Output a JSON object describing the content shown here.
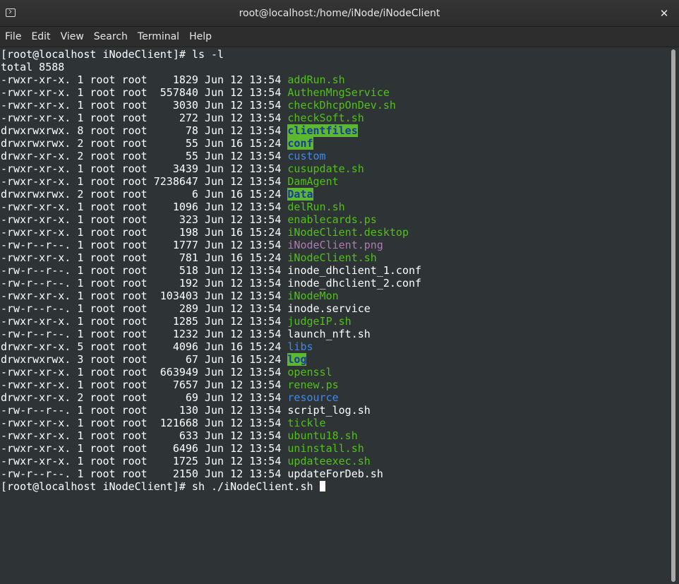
{
  "window": {
    "title": "root@localhost:/home/iNode/iNodeClient",
    "close_label": "✕"
  },
  "menu": {
    "items": [
      "File",
      "Edit",
      "View",
      "Search",
      "Terminal",
      "Help"
    ]
  },
  "terminal": {
    "prompt1": "[root@localhost iNodeClient]# ls -l",
    "total": "total 8588",
    "entries": [
      {
        "meta": "-rwxr-xr-x. 1 root root    1829 Jun 12 13:54 ",
        "name": "addRun.sh",
        "type": "exec"
      },
      {
        "meta": "-rwxr-xr-x. 1 root root  557840 Jun 12 13:54 ",
        "name": "AuthenMngService",
        "type": "exec"
      },
      {
        "meta": "-rwxr-xr-x. 1 root root    3030 Jun 12 13:54 ",
        "name": "checkDhcpOnDev.sh",
        "type": "exec"
      },
      {
        "meta": "-rwxr-xr-x. 1 root root     272 Jun 12 13:54 ",
        "name": "checkSoft.sh",
        "type": "exec"
      },
      {
        "meta": "drwxrwxrwx. 8 root root      78 Jun 12 13:54 ",
        "name": "clientfiles",
        "type": "sticky"
      },
      {
        "meta": "drwxrwxrwx. 2 root root      55 Jun 16 15:24 ",
        "name": "conf",
        "type": "sticky"
      },
      {
        "meta": "drwxr-xr-x. 2 root root      55 Jun 12 13:54 ",
        "name": "custom",
        "type": "dir"
      },
      {
        "meta": "-rwxr-xr-x. 1 root root    3439 Jun 12 13:54 ",
        "name": "cusupdate.sh",
        "type": "exec"
      },
      {
        "meta": "-rwxr-xr-x. 1 root root 7238647 Jun 12 13:54 ",
        "name": "DamAgent",
        "type": "exec"
      },
      {
        "meta": "drwxrwxrwx. 2 root root       6 Jun 16 15:24 ",
        "name": "Data",
        "type": "sticky"
      },
      {
        "meta": "-rwxr-xr-x. 1 root root    1096 Jun 12 13:54 ",
        "name": "delRun.sh",
        "type": "exec"
      },
      {
        "meta": "-rwxr-xr-x. 1 root root     323 Jun 12 13:54 ",
        "name": "enablecards.ps",
        "type": "exec"
      },
      {
        "meta": "-rwxr-xr-x. 1 root root     198 Jun 16 15:24 ",
        "name": "iNodeClient.desktop",
        "type": "exec"
      },
      {
        "meta": "-rw-r--r--. 1 root root    1777 Jun 12 13:54 ",
        "name": "iNodeClient.png",
        "type": "img"
      },
      {
        "meta": "-rwxr-xr-x. 1 root root     781 Jun 16 15:24 ",
        "name": "iNodeClient.sh",
        "type": "exec"
      },
      {
        "meta": "-rw-r--r--. 1 root root     518 Jun 12 13:54 ",
        "name": "inode_dhclient_1.conf",
        "type": "plain"
      },
      {
        "meta": "-rw-r--r--. 1 root root     192 Jun 12 13:54 ",
        "name": "inode_dhclient_2.conf",
        "type": "plain"
      },
      {
        "meta": "-rwxr-xr-x. 1 root root  103403 Jun 12 13:54 ",
        "name": "iNodeMon",
        "type": "exec"
      },
      {
        "meta": "-rw-r--r--. 1 root root     289 Jun 12 13:54 ",
        "name": "inode.service",
        "type": "plain"
      },
      {
        "meta": "-rwxr-xr-x. 1 root root    1285 Jun 12 13:54 ",
        "name": "judgeIP.sh",
        "type": "exec"
      },
      {
        "meta": "-rw-r--r--. 1 root root    1232 Jun 12 13:54 ",
        "name": "launch_nft.sh",
        "type": "plain"
      },
      {
        "meta": "drwxr-xr-x. 5 root root    4096 Jun 16 15:24 ",
        "name": "libs",
        "type": "dir"
      },
      {
        "meta": "drwxrwxrwx. 3 root root      67 Jun 16 15:24 ",
        "name": "log",
        "type": "sticky"
      },
      {
        "meta": "-rwxr-xr-x. 1 root root  663949 Jun 12 13:54 ",
        "name": "openssl",
        "type": "exec"
      },
      {
        "meta": "-rwxr-xr-x. 1 root root    7657 Jun 12 13:54 ",
        "name": "renew.ps",
        "type": "exec"
      },
      {
        "meta": "drwxr-xr-x. 2 root root      69 Jun 12 13:54 ",
        "name": "resource",
        "type": "dir"
      },
      {
        "meta": "-rw-r--r--. 1 root root     130 Jun 12 13:54 ",
        "name": "script_log.sh",
        "type": "plain"
      },
      {
        "meta": "-rwxr-xr-x. 1 root root  121668 Jun 12 13:54 ",
        "name": "tickle",
        "type": "exec"
      },
      {
        "meta": "-rwxr-xr-x. 1 root root     633 Jun 12 13:54 ",
        "name": "ubuntu18.sh",
        "type": "exec"
      },
      {
        "meta": "-rwxr-xr-x. 1 root root    6496 Jun 12 13:54 ",
        "name": "uninstall.sh",
        "type": "exec"
      },
      {
        "meta": "-rwxr-xr-x. 1 root root    1725 Jun 12 13:54 ",
        "name": "updateexec.sh",
        "type": "exec"
      },
      {
        "meta": "-rw-r--r--. 1 root root    2150 Jun 12 13:54 ",
        "name": "updateForDeb.sh",
        "type": "plain"
      }
    ],
    "prompt2": "[root@localhost iNodeClient]# sh ./iNodeClient.sh "
  },
  "icons": {
    "title_icon": "terminal-icon",
    "close": "close-icon"
  },
  "colors": {
    "background": "#2e3436",
    "exec": "#50c017",
    "dir": "#3f88e8",
    "image": "#b07ab0",
    "sticky_bg": "#5cb82e",
    "sticky_fg": "#1b3a9a"
  }
}
